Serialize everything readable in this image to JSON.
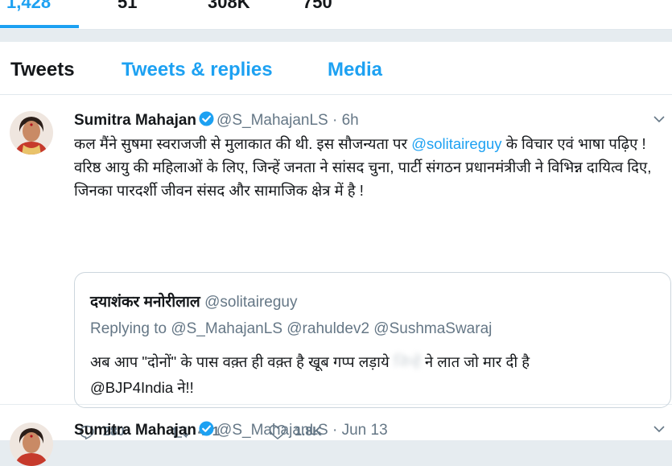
{
  "stats": [
    "1,428",
    "51",
    "308K",
    "750"
  ],
  "tabs": {
    "tweets": "Tweets",
    "replies": "Tweets & replies",
    "media": "Media"
  },
  "tweet1": {
    "name": "Sumitra Mahajan",
    "handle": "@S_MahajanLS",
    "sep": "·",
    "time": "6h",
    "text_a": "कल मैंने सुषमा स्वराजजी से मुलाकात की थी. इस सौजन्यता पर",
    "mention": "@solitaireguy",
    "text_b": "के विचार एवं भाषा पढ़िए ! वरिष्ठ आयु की महिलाओं के लिए, जिन्हें जनता ने सांसद चुना, पार्टी संगठन प्रधानमंत्रीजी ने विभिन्न दायित्व दिए, जिनका पारदर्शी जीवन संसद और सामाजिक क्षेत्र में है !",
    "quote": {
      "name": "दयाशंकर मनोरीलाल",
      "handle": "@solitaireguy",
      "replying_prefix": "Replying to",
      "replying_to": "@S_MahajanLS @rahuldev2 @SushmaSwaraj",
      "text_a": "अब आप \"दोनों\" के पास वक़्त ही वक़्त है खूब गप्प लड़ाये",
      "text_blur": "जिन्हें",
      "text_b": "ने लात जो मार दी है",
      "mention": "@BJP4India",
      "text_c": "ने!!"
    },
    "replies": "280",
    "retweets": "471",
    "likes": "1.8K"
  },
  "tweet2": {
    "name": "Sumitra Mahajan",
    "handle": "@S_MahajanLS",
    "sep": "·",
    "time": "Jun 13"
  },
  "colors": {
    "accent": "#1da1f2",
    "text": "#14171a",
    "muted": "#657786",
    "border": "#e1e8ed"
  }
}
